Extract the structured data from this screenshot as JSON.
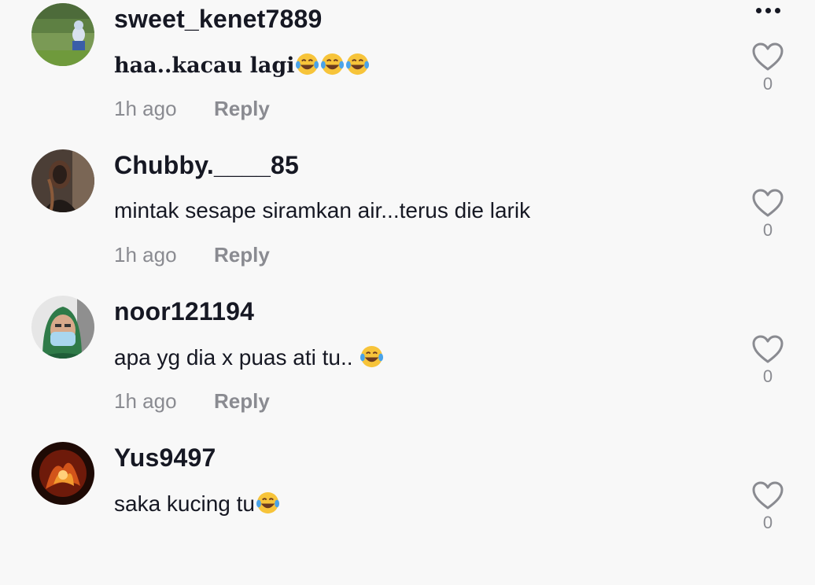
{
  "more_menu": {
    "icon": "more-horizontal-icon"
  },
  "comments": [
    {
      "username": "sweet_kenet7889",
      "text": "haa..kacau lagi",
      "emoji_count": 3,
      "time": "1h ago",
      "reply_label": "Reply",
      "likes": "0"
    },
    {
      "username": "Chubby.____85",
      "text": "mintak sesape siramkan air...terus die larik",
      "emoji_count": 0,
      "time": "1h ago",
      "reply_label": "Reply",
      "likes": "0"
    },
    {
      "username": "noor121194",
      "text": "apa yg dia x puas ati tu.. ",
      "emoji_count": 1,
      "time": "1h ago",
      "reply_label": "Reply",
      "likes": "0"
    },
    {
      "username": "Yus9497",
      "text": "saka kucing tu",
      "emoji_count": 1,
      "time": "",
      "reply_label": "",
      "likes": "0"
    }
  ],
  "colors": {
    "background": "#f8f8f8",
    "text_primary": "#161823",
    "text_secondary": "#8a8b91",
    "emoji_face": "#f7c43a",
    "emoji_tear": "#4aa3e8"
  }
}
